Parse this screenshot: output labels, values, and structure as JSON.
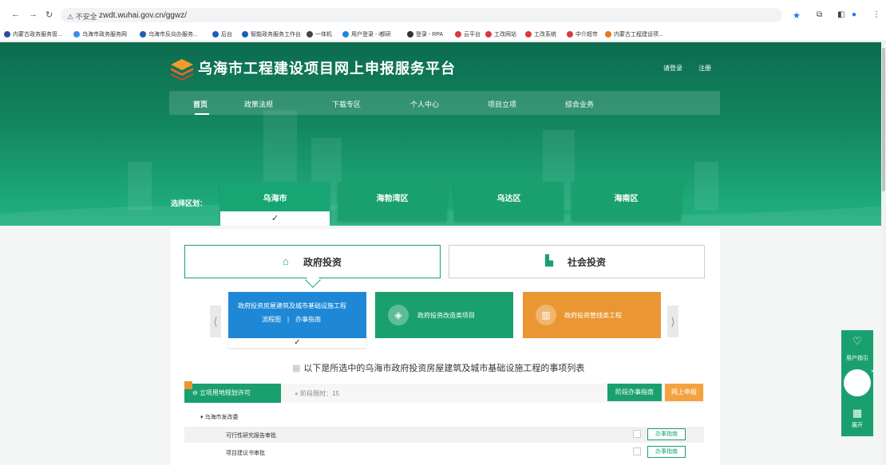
{
  "browser": {
    "security_label": "不安全",
    "url": "zwdt.wuhai.gov.cn/ggwz/",
    "bookmarks": [
      {
        "label": "内蒙古政务服务管...",
        "color": "#2b4ea2"
      },
      {
        "label": "乌海市政务服务网",
        "color": "#3b8ee0"
      },
      {
        "label": "乌海市反向办服务...",
        "color": "#1e5fb8"
      },
      {
        "label": "后台",
        "color": "#1e5fb8"
      },
      {
        "label": "智能政务服务工作台",
        "color": "#1e5fb8"
      },
      {
        "label": "一体机",
        "color": "#444444"
      },
      {
        "label": "用户登录 - i都研",
        "color": "#1e88d7"
      },
      {
        "label": "登录 - RPA",
        "color": "#333333"
      },
      {
        "label": "云平台",
        "color": "#d83b3b"
      },
      {
        "label": "工改网站",
        "color": "#d83b3b"
      },
      {
        "label": "工改系统",
        "color": "#d83b3b"
      },
      {
        "label": "中介超市",
        "color": "#d83b3b"
      },
      {
        "label": "内蒙古工程建设项...",
        "color": "#e8761e"
      }
    ]
  },
  "header": {
    "title": "乌海市工程建设项目网上申报服务平台",
    "login": "请登录",
    "register": "注册"
  },
  "nav": {
    "items": [
      "首页",
      "政策法规",
      "下载专区",
      "个人中心",
      "项目立项",
      "综合业务"
    ],
    "active_index": 0
  },
  "district": {
    "label": "选择区划：",
    "options": [
      "乌海市",
      "海勃湾区",
      "乌达区",
      "海南区"
    ],
    "selected_index": 0
  },
  "investment_tabs": {
    "gov": "政府投资",
    "social": "社会投资",
    "active": "gov"
  },
  "cards": [
    {
      "title": "政府投资房屋建筑及城市基础设施工程",
      "links": "流程图　|　办事指南",
      "selected": true
    },
    {
      "title": "政府投资改造类项目"
    },
    {
      "title": "政府投资管线类工程"
    }
  ],
  "list": {
    "heading": "以下是所选中的乌海市政府投资房屋建筑及城市基础设施工程的事项列表",
    "stage": "立项用地规划许可",
    "time_limit": "阶段限时：15",
    "guide_button": "阶段办事指南",
    "apply_button": "网上申报",
    "department": "▾ 乌海市发改委",
    "items": [
      {
        "label": "可行性研究报告审批",
        "button": "办事指南"
      },
      {
        "label": "项目建议书审批",
        "button": "办事指南"
      }
    ]
  },
  "float_bar": {
    "guide_label": "用户指引",
    "expand_label": "展开"
  },
  "colors": {
    "primary_green": "#1aa06e",
    "hero_dark": "#0c6b4f",
    "blue_card": "#1e88d7",
    "orange": "#ea9632"
  }
}
